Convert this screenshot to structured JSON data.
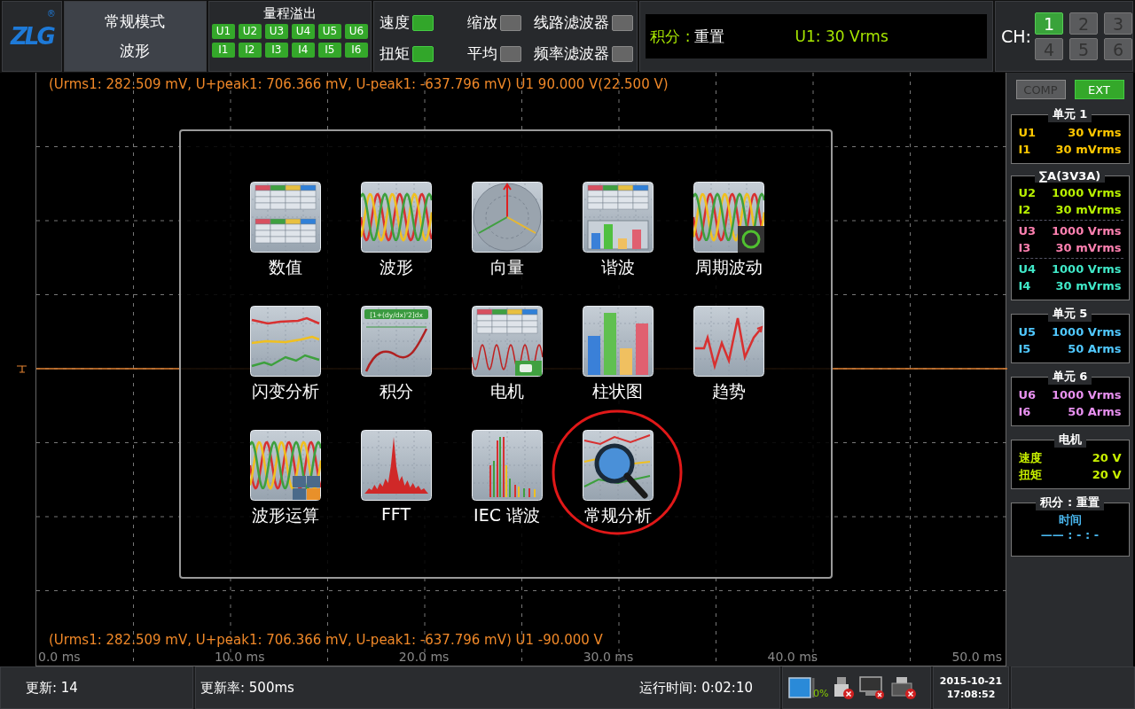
{
  "logo": {
    "text": "ZLG",
    "mark": "®"
  },
  "mode": {
    "line1": "常规模式",
    "line2": "波形"
  },
  "overflow": {
    "title": "量程溢出",
    "flags": [
      {
        "label": "U1",
        "on": true
      },
      {
        "label": "U2",
        "on": true
      },
      {
        "label": "U3",
        "on": true
      },
      {
        "label": "U4",
        "on": true
      },
      {
        "label": "U5",
        "on": true
      },
      {
        "label": "U6",
        "on": true
      },
      {
        "label": "I1",
        "on": true
      },
      {
        "label": "I2",
        "on": true
      },
      {
        "label": "I3",
        "on": true
      },
      {
        "label": "I4",
        "on": true
      },
      {
        "label": "I5",
        "on": true
      },
      {
        "label": "I6",
        "on": true
      }
    ]
  },
  "toggles": [
    {
      "label": "速度",
      "on": true
    },
    {
      "label": "缩放",
      "on": false
    },
    {
      "label": "线路滤波器",
      "on": false
    },
    {
      "label": "扭矩",
      "on": true
    },
    {
      "label": "平均",
      "on": false
    },
    {
      "label": "频率滤波器",
      "on": false
    }
  ],
  "display": {
    "label": "积分 :",
    "value": "重置",
    "reading": "U1: 30 Vrms"
  },
  "channel_select": {
    "label": "CH:",
    "buttons": [
      {
        "label": "1",
        "selected": true
      },
      {
        "label": "2",
        "selected": false
      },
      {
        "label": "3",
        "selected": false
      },
      {
        "label": "4",
        "selected": false
      },
      {
        "label": "5",
        "selected": false
      },
      {
        "label": "6",
        "selected": false
      }
    ]
  },
  "scope": {
    "top_readout": "(Urms1: 282.509 mV, U+peak1: 706.366 mV, U-peak1: -637.796 mV) U1    90.000 V(22.500 V)",
    "bottom_readout": "(Urms1: 282.509 mV, U+peak1: 706.366 mV, U-peak1: -637.796 mV) U1    -90.000 V",
    "xticks": [
      "0.0 ms",
      "10.0 ms",
      "20.0 ms",
      "30.0 ms",
      "40.0 ms",
      "50.0 ms"
    ]
  },
  "menu": {
    "items": [
      {
        "label": "数值",
        "kind": "table",
        "selected": false
      },
      {
        "label": "波形",
        "kind": "wave",
        "selected": false
      },
      {
        "label": "向量",
        "kind": "vector",
        "selected": false
      },
      {
        "label": "谐波",
        "kind": "harmonic",
        "selected": false
      },
      {
        "label": "周期波动",
        "kind": "cycle",
        "selected": false
      },
      {
        "label": "闪变分析",
        "kind": "flicker",
        "selected": false
      },
      {
        "label": "积分",
        "kind": "integral",
        "selected": false,
        "formula": "[1+(dy/dx)'2]dx"
      },
      {
        "label": "电机",
        "kind": "motor",
        "selected": false
      },
      {
        "label": "柱状图",
        "kind": "bar",
        "selected": false
      },
      {
        "label": "趋势",
        "kind": "trend",
        "selected": false
      },
      {
        "label": "波形运算",
        "kind": "wavemath",
        "selected": false
      },
      {
        "label": "FFT",
        "kind": "fft",
        "selected": false
      },
      {
        "label": "IEC 谐波",
        "kind": "iec",
        "selected": false
      },
      {
        "label": "常规分析",
        "kind": "analysis",
        "selected": true
      }
    ]
  },
  "side": {
    "buttons": [
      {
        "label": "COMP",
        "on": false
      },
      {
        "label": "EXT",
        "on": true
      }
    ],
    "groups": [
      {
        "title": "单元 1",
        "kind": "channels",
        "sections": [
          [
            {
              "name": "U1",
              "value": "30 Vrms",
              "color": "#ffc800"
            },
            {
              "name": "I1",
              "value": "30 mVrms",
              "color": "#ffc800"
            }
          ]
        ]
      },
      {
        "title": "∑A(3V3A)",
        "kind": "channels",
        "sections": [
          [
            {
              "name": "U2",
              "value": "1000 Vrms",
              "color": "#b8f000"
            },
            {
              "name": "I2",
              "value": "30 mVrms",
              "color": "#b8f000"
            }
          ],
          [
            {
              "name": "U3",
              "value": "1000 Vrms",
              "color": "#ff80b0"
            },
            {
              "name": "I3",
              "value": "30 mVrms",
              "color": "#ff80b0"
            }
          ],
          [
            {
              "name": "U4",
              "value": "1000 Vrms",
              "color": "#40e8c8"
            },
            {
              "name": "I4",
              "value": "30 mVrms",
              "color": "#40e8c8"
            }
          ]
        ]
      },
      {
        "title": "单元 5",
        "kind": "channels",
        "sections": [
          [
            {
              "name": "U5",
              "value": "1000 Vrms",
              "color": "#50c8ff"
            },
            {
              "name": "I5",
              "value": "50 Arms",
              "color": "#50c8ff"
            }
          ]
        ]
      },
      {
        "title": "单元 6",
        "kind": "channels",
        "sections": [
          [
            {
              "name": "U6",
              "value": "1000 Vrms",
              "color": "#e890f0"
            },
            {
              "name": "I6",
              "value": "50 Arms",
              "color": "#e890f0"
            }
          ]
        ]
      },
      {
        "title": "电机",
        "kind": "channels",
        "sections": [
          [
            {
              "name": "速度",
              "value": "20 V",
              "color": "#c8f000"
            },
            {
              "name": "扭矩",
              "value": "20 V",
              "color": "#c8f000"
            }
          ]
        ]
      },
      {
        "title": "积分 : 重置",
        "kind": "timer",
        "label": "时间",
        "value": "—— : - : -"
      }
    ]
  },
  "status": {
    "updates": "更新: 14",
    "rate": "更新率: 500ms",
    "runtime_label": "运行时间:",
    "runtime": "0:02:10",
    "cpu": "0%",
    "date": "2015-10-21",
    "time": "17:08:52"
  }
}
